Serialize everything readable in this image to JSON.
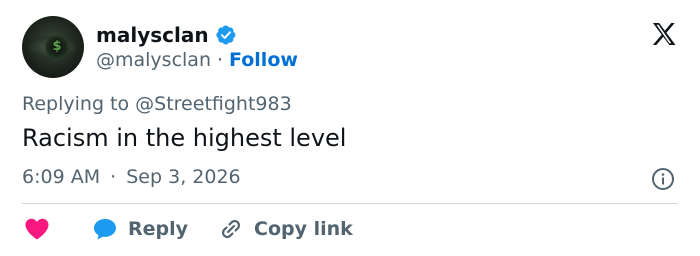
{
  "author": {
    "display_name": "malysclan",
    "handle": "@malysclan",
    "separator": "·",
    "follow_label": "Follow",
    "avatar_glyph": "$",
    "verified_icon": "verified-badge-icon"
  },
  "tweet": {
    "replying_to": "Replying to @Streetfight983",
    "text": "Racism in the highest level",
    "time": "6:09 AM",
    "separator": "·",
    "date": "Sep 3, 2026"
  },
  "actions": {
    "reply_label": "Reply",
    "copy_link_label": "Copy link"
  },
  "icons": [
    "x-logo-icon",
    "info-icon",
    "heart-icon",
    "reply-bubble-icon",
    "link-icon",
    "verified-badge-icon"
  ],
  "colors": {
    "accent": "#006fd6",
    "verified": "#1d9bf0",
    "heart": "#f91880",
    "muted_text": "#536471",
    "primary_text": "#0f1419",
    "divider": "#cfd9de"
  }
}
